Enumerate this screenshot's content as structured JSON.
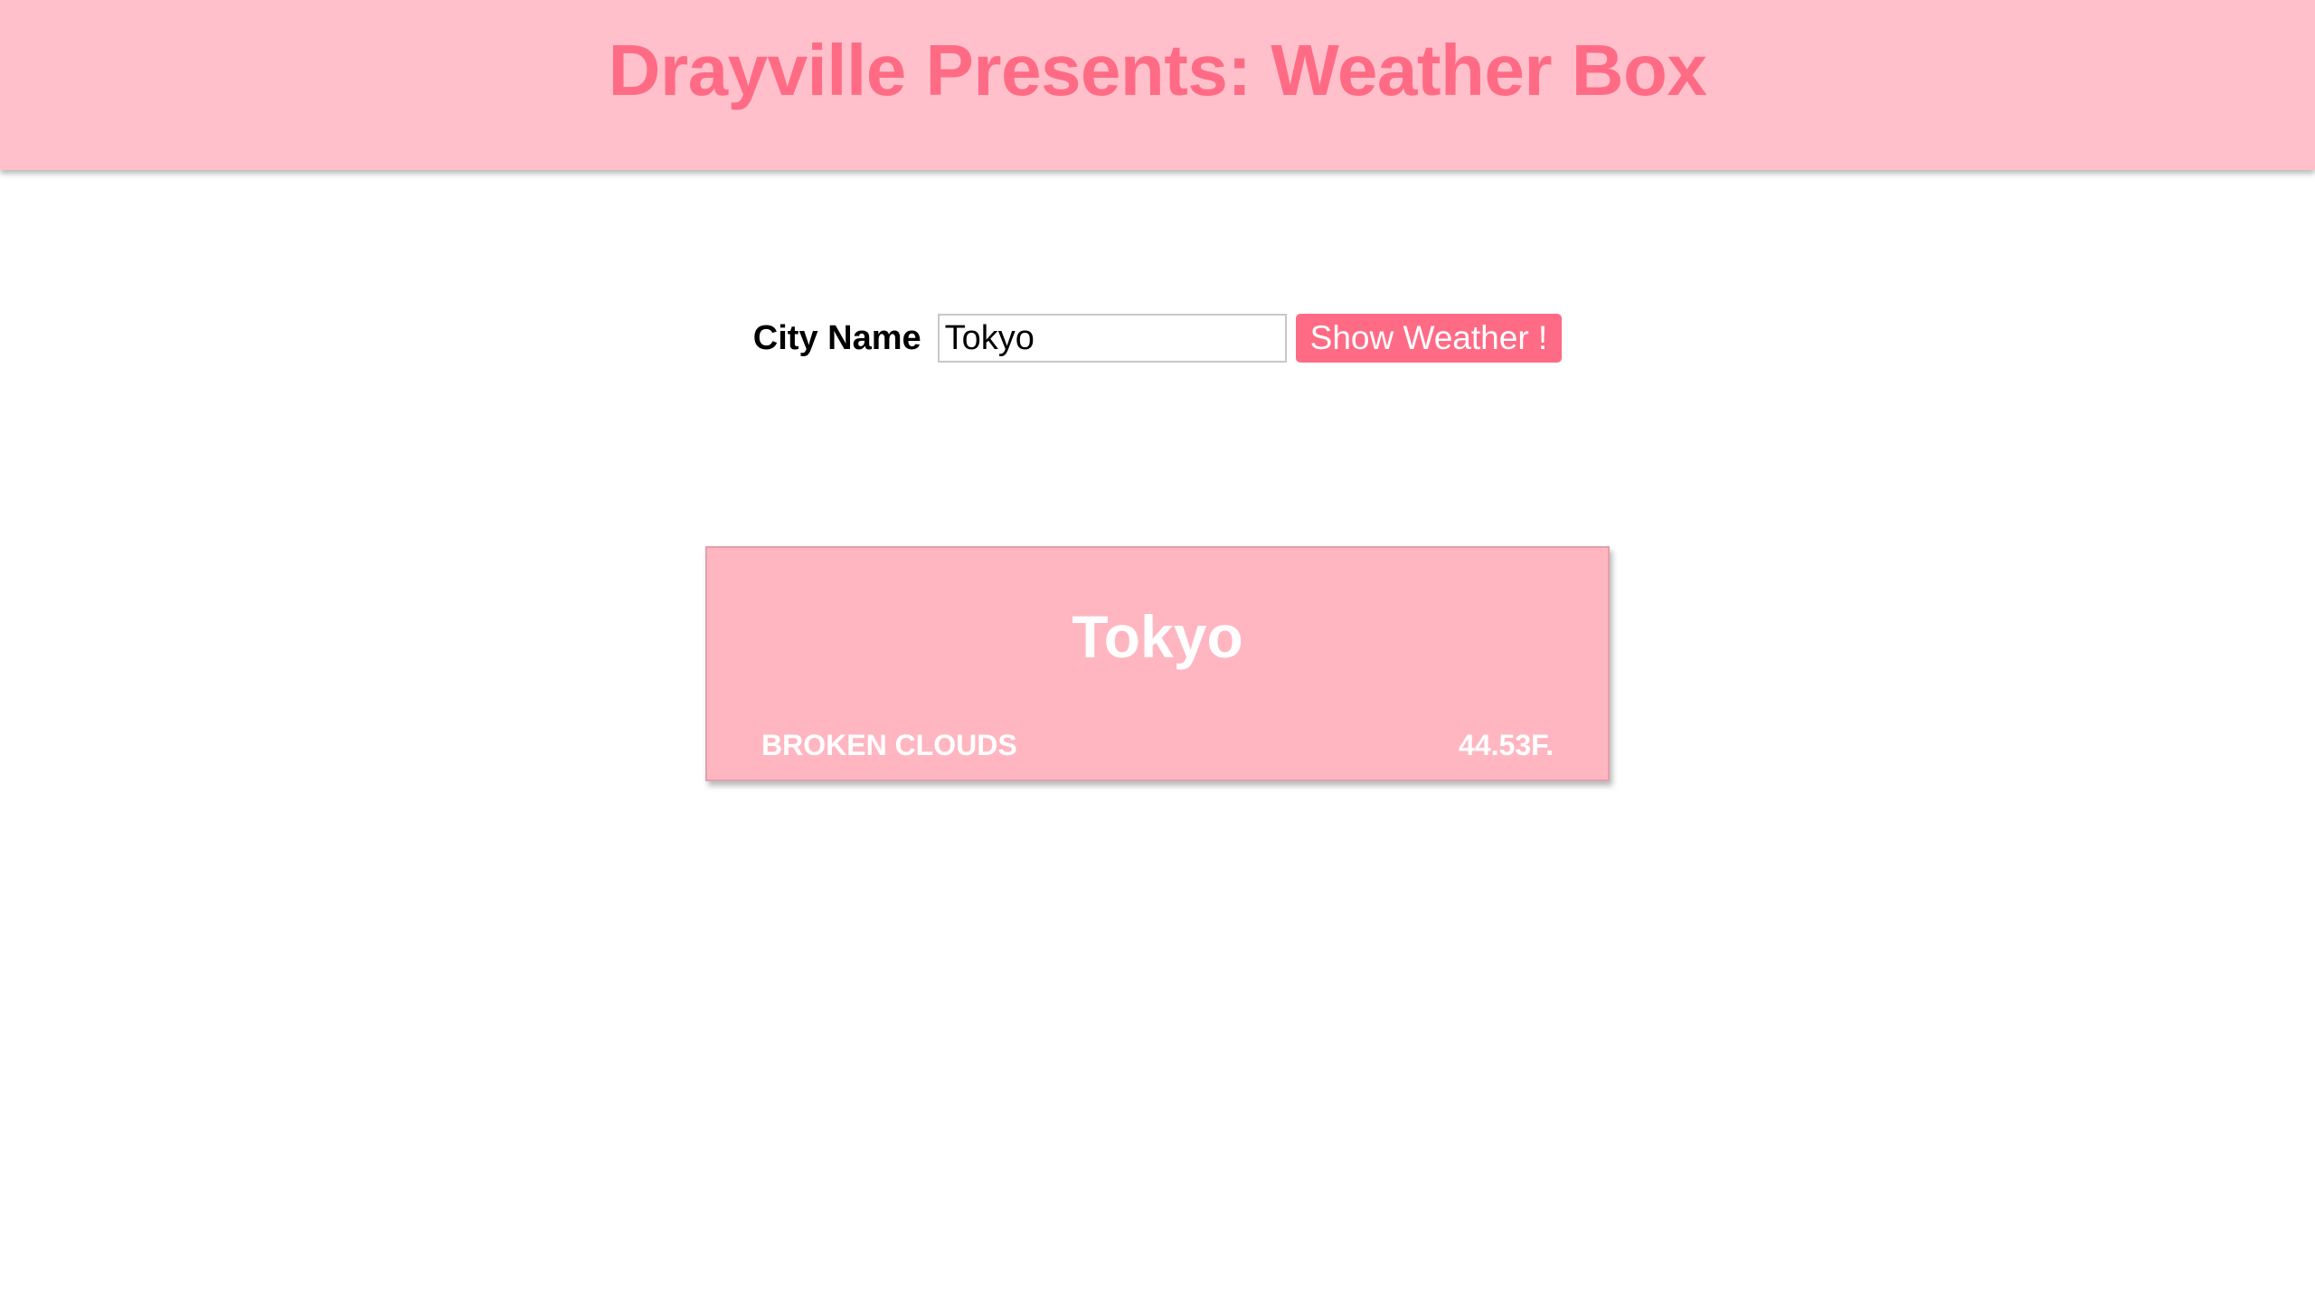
{
  "header": {
    "title": "Drayville Presents: Weather Box"
  },
  "form": {
    "city_label": "City Name",
    "city_value": "Tokyo",
    "button_label": "Show Weather !"
  },
  "weather": {
    "city": "Tokyo",
    "description": "BROKEN CLOUDS",
    "temperature": "44.53F."
  },
  "colors": {
    "header_bg": "#ffc0cb",
    "accent": "#ff6b85",
    "card_bg": "#ffb6c1",
    "card_text": "#ffffff"
  }
}
